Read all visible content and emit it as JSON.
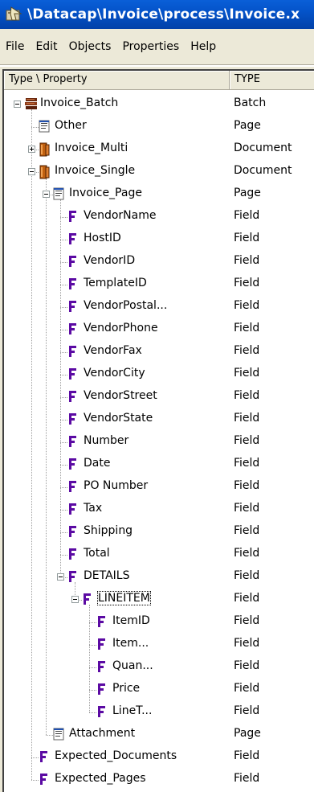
{
  "window": {
    "title": "\\Datacap\\Invoice\\process\\Invoice.x"
  },
  "menu": [
    "File",
    "Edit",
    "Objects",
    "Properties",
    "Help"
  ],
  "columns": {
    "name": "Type \\ Property",
    "type": "TYPE"
  },
  "tree": [
    {
      "label": "Invoice_Batch",
      "type": "Batch",
      "level": 0,
      "icon": "batch-icon",
      "toggle": "minus"
    },
    {
      "label": "Other",
      "type": "Page",
      "level": 1,
      "icon": "page-icon"
    },
    {
      "label": "Invoice_Multi",
      "type": "Document",
      "level": 1,
      "icon": "document-icon",
      "toggle": "plus"
    },
    {
      "label": "Invoice_Single",
      "type": "Document",
      "level": 1,
      "icon": "document-icon",
      "toggle": "minus"
    },
    {
      "label": "Invoice_Page",
      "type": "Page",
      "level": 2,
      "icon": "page-icon",
      "toggle": "minus"
    },
    {
      "label": "VendorName",
      "type": "Field",
      "level": 3,
      "icon": "field-icon"
    },
    {
      "label": "HostID",
      "type": "Field",
      "level": 3,
      "icon": "field-icon"
    },
    {
      "label": "VendorID",
      "type": "Field",
      "level": 3,
      "icon": "field-icon"
    },
    {
      "label": "TemplateID",
      "type": "Field",
      "level": 3,
      "icon": "field-icon"
    },
    {
      "label": "VendorPostal...",
      "type": "Field",
      "level": 3,
      "icon": "field-icon"
    },
    {
      "label": "VendorPhone",
      "type": "Field",
      "level": 3,
      "icon": "field-icon"
    },
    {
      "label": "VendorFax",
      "type": "Field",
      "level": 3,
      "icon": "field-icon"
    },
    {
      "label": "VendorCity",
      "type": "Field",
      "level": 3,
      "icon": "field-icon"
    },
    {
      "label": "VendorStreet",
      "type": "Field",
      "level": 3,
      "icon": "field-icon"
    },
    {
      "label": "VendorState",
      "type": "Field",
      "level": 3,
      "icon": "field-icon"
    },
    {
      "label": "Number",
      "type": "Field",
      "level": 3,
      "icon": "field-icon"
    },
    {
      "label": "Date",
      "type": "Field",
      "level": 3,
      "icon": "field-icon"
    },
    {
      "label": "PO Number",
      "type": "Field",
      "level": 3,
      "icon": "field-icon"
    },
    {
      "label": "Tax",
      "type": "Field",
      "level": 3,
      "icon": "field-icon"
    },
    {
      "label": "Shipping",
      "type": "Field",
      "level": 3,
      "icon": "field-icon"
    },
    {
      "label": "Total",
      "type": "Field",
      "level": 3,
      "icon": "field-icon"
    },
    {
      "label": "DETAILS",
      "type": "Field",
      "level": 3,
      "icon": "field-icon",
      "toggle": "minus"
    },
    {
      "label": "LINEITEM",
      "type": "Field",
      "level": 4,
      "icon": "field-icon",
      "toggle": "minus",
      "selected": true
    },
    {
      "label": "ItemID",
      "type": "Field",
      "level": 5,
      "icon": "field-icon"
    },
    {
      "label": "Item...",
      "type": "Field",
      "level": 5,
      "icon": "field-icon"
    },
    {
      "label": "Quan...",
      "type": "Field",
      "level": 5,
      "icon": "field-icon"
    },
    {
      "label": "Price",
      "type": "Field",
      "level": 5,
      "icon": "field-icon"
    },
    {
      "label": "LineT...",
      "type": "Field",
      "level": 5,
      "icon": "field-icon"
    },
    {
      "label": "Attachment",
      "type": "Page",
      "level": 2,
      "icon": "page-icon"
    },
    {
      "label": "Expected_Documents",
      "type": "Field",
      "level": 1,
      "icon": "field-icon"
    },
    {
      "label": "Expected_Pages",
      "type": "Field",
      "level": 1,
      "icon": "field-icon"
    }
  ]
}
